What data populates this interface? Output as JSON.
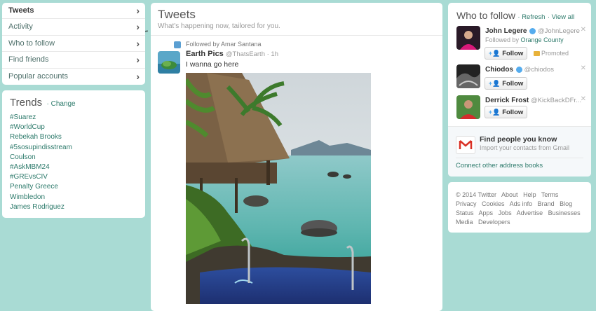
{
  "nav": {
    "items": [
      {
        "label": "Tweets"
      },
      {
        "label": "Activity"
      },
      {
        "label": "Who to follow"
      },
      {
        "label": "Find friends"
      },
      {
        "label": "Popular accounts"
      }
    ]
  },
  "trends": {
    "title": "Trends",
    "change": "· Change",
    "items": [
      "#Suarez",
      "#WorldCup",
      "Rebekah Brooks",
      "#5sosupindisstream",
      "Coulson",
      "#AskMBM24",
      "#GREvsCIV",
      "Penalty Greece",
      "Wimbledon",
      "James Rodriguez"
    ]
  },
  "main": {
    "title": "Tweets",
    "subtitle": "What's happening now, tailored for you."
  },
  "tweet": {
    "followed_by": "Followed by Amar Santana",
    "name": "Earth Pics",
    "handle": "@ThatsEarth · 1h",
    "text": "I wanna go here"
  },
  "who_to_follow": {
    "title": "Who to follow",
    "refresh": "· Refresh",
    "view_all": "· View all",
    "accounts": [
      {
        "name": "John Legere",
        "handle": "@JohnLegere",
        "sub_prefix": "Followed by",
        "sub_link": "Orange County",
        "follow": "Follow",
        "promoted": "Promoted"
      },
      {
        "name": "Chiodos",
        "handle": "@chiodos",
        "follow": "Follow"
      },
      {
        "name": "Derrick Frost",
        "handle": "@KickBackDFr...",
        "follow": "Follow"
      }
    ],
    "find_title": "Find people you know",
    "find_sub": "Import your contacts from Gmail",
    "connect": "Connect other address books"
  },
  "footer": {
    "links": [
      "© 2014 Twitter",
      "About",
      "Help",
      "Terms",
      "Privacy",
      "Cookies",
      "Ads info",
      "Brand",
      "Blog",
      "Status",
      "Apps",
      "Jobs",
      "Advertise",
      "Businesses",
      "Media",
      "Developers"
    ]
  },
  "colors": {
    "background": "#a9dbd4",
    "accent": "#2d7a6b",
    "verified": "#55acee"
  }
}
